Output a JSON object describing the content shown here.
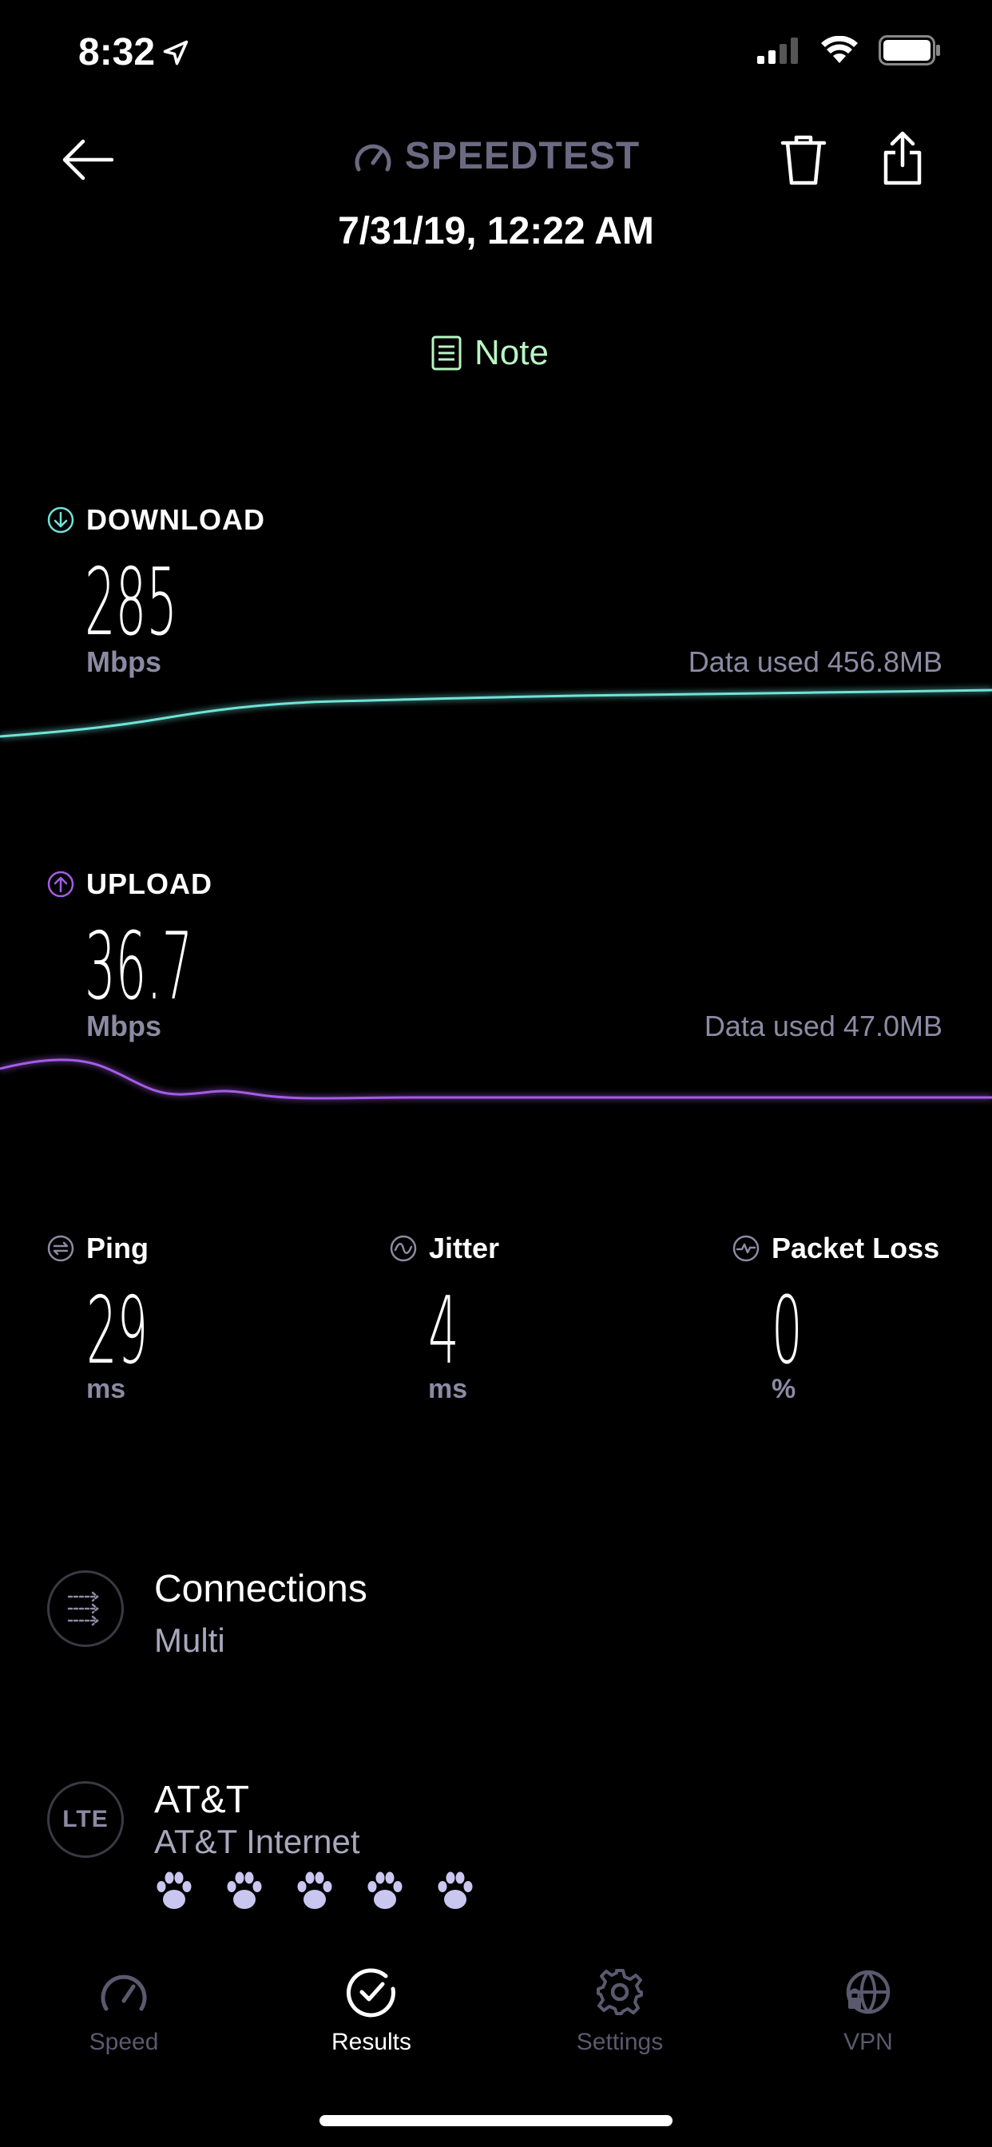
{
  "status_bar": {
    "time": "8:32",
    "location_icon": "location-arrow-icon",
    "signal_icon": "cellular-signal-icon",
    "wifi_icon": "wifi-icon",
    "battery_icon": "battery-icon"
  },
  "header": {
    "logo_text": "SPEEDTEST",
    "datetime": "7/31/19, 12:22 AM",
    "note_label": "Note"
  },
  "download": {
    "label": "DOWNLOAD",
    "value": "285",
    "unit": "Mbps",
    "data_used": "Data used 456.8MB",
    "color": "#6fe3d8"
  },
  "upload": {
    "label": "UPLOAD",
    "value": "36.7",
    "unit": "Mbps",
    "data_used": "Data used 47.0MB",
    "color": "#a55ce6"
  },
  "ping": {
    "label": "Ping",
    "value": "29",
    "unit": "ms"
  },
  "jitter": {
    "label": "Jitter",
    "value": "4",
    "unit": "ms"
  },
  "packet_loss": {
    "label": "Packet Loss",
    "value": "0",
    "unit": "%"
  },
  "connections": {
    "title": "Connections",
    "value": "Multi"
  },
  "provider": {
    "badge": "LTE",
    "name": "AT&T",
    "server": "AT&T Internet",
    "paw_rating": 5
  },
  "tabs": [
    {
      "label": "Speed",
      "icon": "speedometer-icon",
      "active": false
    },
    {
      "label": "Results",
      "icon": "results-check-icon",
      "active": true
    },
    {
      "label": "Settings",
      "icon": "settings-gear-icon",
      "active": false
    },
    {
      "label": "VPN",
      "icon": "vpn-globe-icon",
      "active": false
    }
  ],
  "colors": {
    "background": "#000000",
    "note_green": "#b9f5c2",
    "muted": "#8c8aa3",
    "tab_inactive": "#5a596e"
  }
}
